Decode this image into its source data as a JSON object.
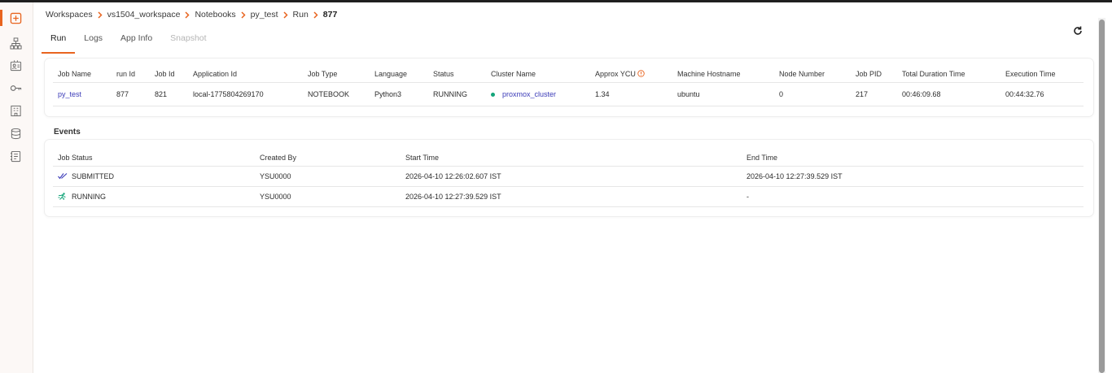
{
  "sidebar": {
    "icons": [
      "plus-square-icon",
      "hierarchy-icon",
      "id-card-icon",
      "key-icon",
      "building-icon",
      "database-icon",
      "notebook-icon"
    ],
    "accent": "#e8641f"
  },
  "breadcrumb": {
    "items": [
      "Workspaces",
      "vs1504_workspace",
      "Notebooks",
      "py_test",
      "Run"
    ],
    "current": "877"
  },
  "tabs": [
    {
      "label": "Run"
    },
    {
      "label": "Logs"
    },
    {
      "label": "App Info"
    },
    {
      "label": "Snapshot"
    }
  ],
  "run_table": {
    "headers": [
      "Job Name",
      "run Id",
      "Job Id",
      "Application Id",
      "Job Type",
      "Language",
      "Status",
      "Cluster Name",
      "Approx YCU",
      "Machine Hostname",
      "Node Number",
      "Job PID",
      "Total Duration Time",
      "Execution Time"
    ],
    "row": [
      "py_test",
      "877",
      "821",
      "local-1775804269170",
      "NOTEBOOK",
      "Python3",
      "RUNNING",
      "proxmox_cluster",
      "1.34",
      "ubuntu",
      "0",
      "217",
      "00:46:09.68",
      "00:44:32.76"
    ]
  },
  "events": {
    "title": "Events",
    "headers": [
      "Job Status",
      "Created By",
      "Start Time",
      "End Time"
    ],
    "rows": [
      [
        "SUBMITTED",
        "YSU0000",
        "2026-04-10 12:26:02.607 IST",
        "2026-04-10 12:27:39.529 IST"
      ],
      [
        "RUNNING",
        "YSU0000",
        "2026-04-10 12:27:39.529 IST",
        "-"
      ]
    ]
  },
  "colors": {
    "accent": "#e8641f",
    "link": "#3b3bb8",
    "running_dot": "#14a57a",
    "submitted_icon": "#3b3bb8",
    "running_icon": "#14a57a",
    "info_icon": "#e8641f"
  }
}
